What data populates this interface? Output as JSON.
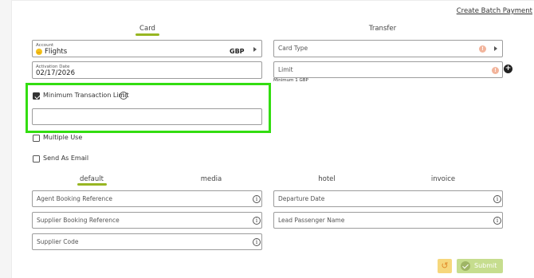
{
  "header": {
    "batch_link": "Create Batch Payment"
  },
  "main_tabs": [
    {
      "label": "Card",
      "active": true
    },
    {
      "label": "Transfer",
      "active": false
    }
  ],
  "account": {
    "label": "Account",
    "value": "Flights",
    "currency": "GBP"
  },
  "card_type": {
    "placeholder": "Card Type"
  },
  "activation_date": {
    "label": "Activation Date",
    "value": "02/17/2026"
  },
  "limit": {
    "placeholder": "Limit",
    "hint": "Minimum 1 GBP"
  },
  "min_transaction": {
    "label": "Minimum Transaction Limit",
    "checked": true,
    "input_value": ""
  },
  "multiple_use": {
    "label": "Multiple Use",
    "checked": false
  },
  "send_as_email": {
    "label": "Send As Email",
    "checked": false
  },
  "sub_tabs": [
    {
      "label": "default",
      "active": true
    },
    {
      "label": "media",
      "active": false
    },
    {
      "label": "hotel",
      "active": false
    },
    {
      "label": "invoice",
      "active": false
    }
  ],
  "fields": {
    "agent_booking_reference": "Agent Booking Reference",
    "supplier_booking_reference": "Supplier Booking Reference",
    "supplier_code": "Supplier Code",
    "departure_date": "Departure Date",
    "lead_passenger_name": "Lead Passenger Name"
  },
  "actions": {
    "reset_icon": "undo-icon",
    "submit_label": "Submit"
  },
  "colors": {
    "accent": "#97b622",
    "highlight": "#33dd11",
    "warning": "#f2b49b",
    "submit_bg": "#c6dd8e",
    "reset_bg": "#f6d77c"
  }
}
